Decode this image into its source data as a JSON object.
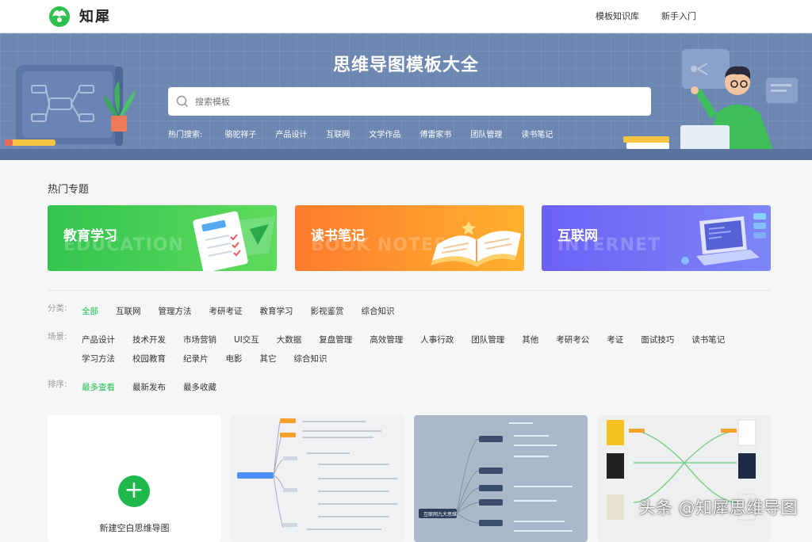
{
  "header": {
    "brand": "知犀",
    "nav": [
      "模板知识库",
      "新手入门"
    ]
  },
  "hero": {
    "title": "思维导图模板大全",
    "search_placeholder": "搜索模板",
    "hot_label": "热门搜索:",
    "hot_terms": [
      "骆驼祥子",
      "产品设计",
      "互联网",
      "文学作品",
      "傅雷家书",
      "团队管理",
      "读书笔记"
    ]
  },
  "topics": {
    "title": "热门专题",
    "items": [
      {
        "label": "教育学习",
        "en": "EDUCATION",
        "color_from": "#33c44f",
        "color_to": "#5edb5c"
      },
      {
        "label": "读书笔记",
        "en": "BOOK NOTES",
        "color_from": "#ff7b2e",
        "color_to": "#ffb12e"
      },
      {
        "label": "互联网",
        "en": "INTERNET",
        "color_from": "#6c60f5",
        "color_to": "#7d86f7"
      }
    ]
  },
  "filters": {
    "category_label": "分类:",
    "categories": [
      "全部",
      "互联网",
      "管理方法",
      "考研考证",
      "教育学习",
      "影视鉴赏",
      "综合知识"
    ],
    "category_active": "全部",
    "scene_label": "场景:",
    "scenes": [
      "产品设计",
      "技术开发",
      "市场营销",
      "UI交互",
      "大数据",
      "复盘管理",
      "高效管理",
      "人事行政",
      "团队管理",
      "其他",
      "考研考公",
      "考证",
      "面试技巧",
      "读书笔记",
      "学习方法",
      "校园教育",
      "纪录片",
      "电影",
      "其它",
      "综合知识"
    ],
    "sort_label": "排序:",
    "sorts": [
      "最多查看",
      "最新发布",
      "最多收藏"
    ],
    "sort_active": "最多查看"
  },
  "templates": {
    "new_label": "新建空白思维导图",
    "plus": "+",
    "card3_center": "互联网九大思维"
  },
  "watermark": "头条 @知犀思维导图",
  "colors": {
    "accent": "#1ec14c",
    "hero_bg": "#6d87b3"
  }
}
